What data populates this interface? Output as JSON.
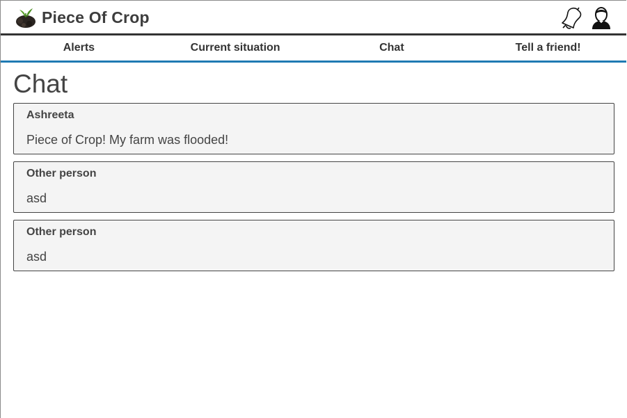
{
  "header": {
    "brand": "Piece Of Crop",
    "icons": [
      "logo-plant-icon",
      "bell-icon",
      "user-icon"
    ]
  },
  "nav": {
    "items": [
      {
        "label": "Alerts"
      },
      {
        "label": "Current situation"
      },
      {
        "label": "Chat"
      },
      {
        "label": "Tell a friend!"
      }
    ]
  },
  "main": {
    "title": "Chat",
    "messages": [
      {
        "author": "Ashreeta",
        "text": "Piece of Crop! My farm was flooded!"
      },
      {
        "author": "Other person",
        "text": "asd"
      },
      {
        "author": "Other person",
        "text": "asd"
      }
    ]
  },
  "colors": {
    "nav_underline": "#1f7ab3",
    "header_rule": "#333333",
    "message_bg": "#f4f4f4"
  }
}
